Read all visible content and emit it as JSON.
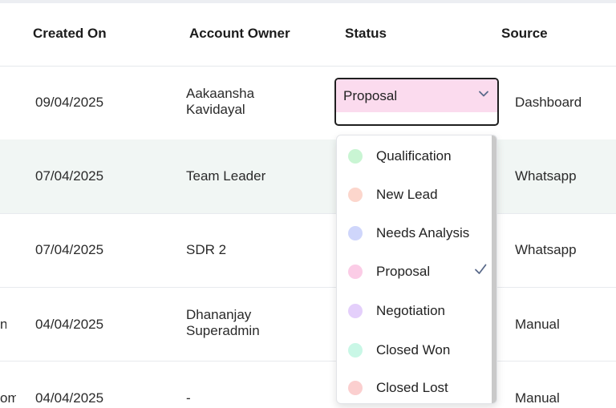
{
  "header": {
    "created_on": "Created On",
    "account_owner": "Account Owner",
    "status": "Status",
    "source": "Source"
  },
  "rows": [
    {
      "lead_fragment": "",
      "created_on": "09/04/2025",
      "owner_line1": "Aakaansha",
      "owner_line2": "Kavidayal",
      "source": "Dashboard"
    },
    {
      "lead_fragment": "",
      "created_on": "07/04/2025",
      "owner_line1": "Team Leader",
      "owner_line2": "",
      "source": "Whatsapp"
    },
    {
      "lead_fragment": "",
      "created_on": "07/04/2025",
      "owner_line1": "SDR 2",
      "owner_line2": "",
      "source": "Whatsapp"
    },
    {
      "lead_fragment": "n",
      "created_on": "04/04/2025",
      "owner_line1": "Dhananjay",
      "owner_line2": "Superadmin",
      "source": "Manual"
    },
    {
      "lead_fragment": "om",
      "created_on": "04/04/2025",
      "owner_line1": "-",
      "owner_line2": "",
      "source": "Manual"
    }
  ],
  "status_select": {
    "value": "Proposal",
    "icon": "chevron-down-icon"
  },
  "status_options": [
    {
      "label": "Qualification",
      "color": "#c9f5d3",
      "selected": false
    },
    {
      "label": "New Lead",
      "color": "#fcd6cc",
      "selected": false
    },
    {
      "label": "Needs Analysis",
      "color": "#cfd6fb",
      "selected": false
    },
    {
      "label": "Proposal",
      "color": "#fbcce6",
      "selected": true
    },
    {
      "label": "Negotiation",
      "color": "#e4cffb",
      "selected": false
    },
    {
      "label": "Closed Won",
      "color": "#c9f7e6",
      "selected": false
    },
    {
      "label": "Closed Lost",
      "color": "#fbcfcf",
      "selected": false
    }
  ],
  "colors": {
    "selected_status_bg": "#fbdbee",
    "alt_row_bg": "#f1f6f4",
    "check_color": "#5a6a8a"
  }
}
